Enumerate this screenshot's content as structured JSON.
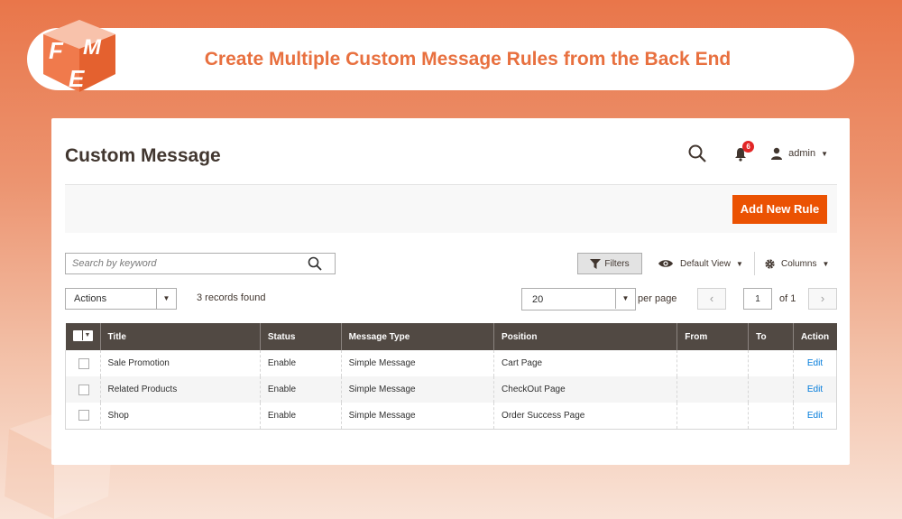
{
  "banner": {
    "title": "Create Multiple Custom Message Rules from the Back End",
    "logo_letters": "FME"
  },
  "page": {
    "title": "Custom Message"
  },
  "header": {
    "notifications_count": "6",
    "user_name": "admin"
  },
  "toolbar": {
    "add_new_rule_label": "Add New Rule"
  },
  "search": {
    "placeholder": "Search by keyword",
    "value": ""
  },
  "controls": {
    "filters_label": "Filters",
    "view_label": "Default View",
    "columns_label": "Columns",
    "actions_label": "Actions",
    "records_found": "3 records found",
    "per_page_value": "20",
    "per_page_label": "per page",
    "current_page": "1",
    "of_pages": "of 1"
  },
  "grid": {
    "headers": [
      "Title",
      "Status",
      "Message Type",
      "Position",
      "From",
      "To",
      "Action"
    ],
    "rows": [
      {
        "title": "Sale Promotion",
        "status": "Enable",
        "message_type": "Simple Message",
        "position": "Cart Page",
        "from": "",
        "to": "",
        "action": "Edit"
      },
      {
        "title": "Related Products",
        "status": "Enable",
        "message_type": "Simple Message",
        "position": "CheckOut Page",
        "from": "",
        "to": "",
        "action": "Edit"
      },
      {
        "title": "Shop",
        "status": "Enable",
        "message_type": "Simple Message",
        "position": "Order Success Page",
        "from": "",
        "to": "",
        "action": "Edit"
      }
    ]
  },
  "colors": {
    "brand_orange": "#e8703f",
    "primary_button": "#eb5202",
    "table_header": "#514943",
    "link": "#007bdb"
  },
  "icons": {
    "search": "search-icon",
    "bell": "bell-icon",
    "user": "user-icon",
    "filter": "filter-icon",
    "eye": "eye-icon",
    "gear": "gear-icon"
  }
}
